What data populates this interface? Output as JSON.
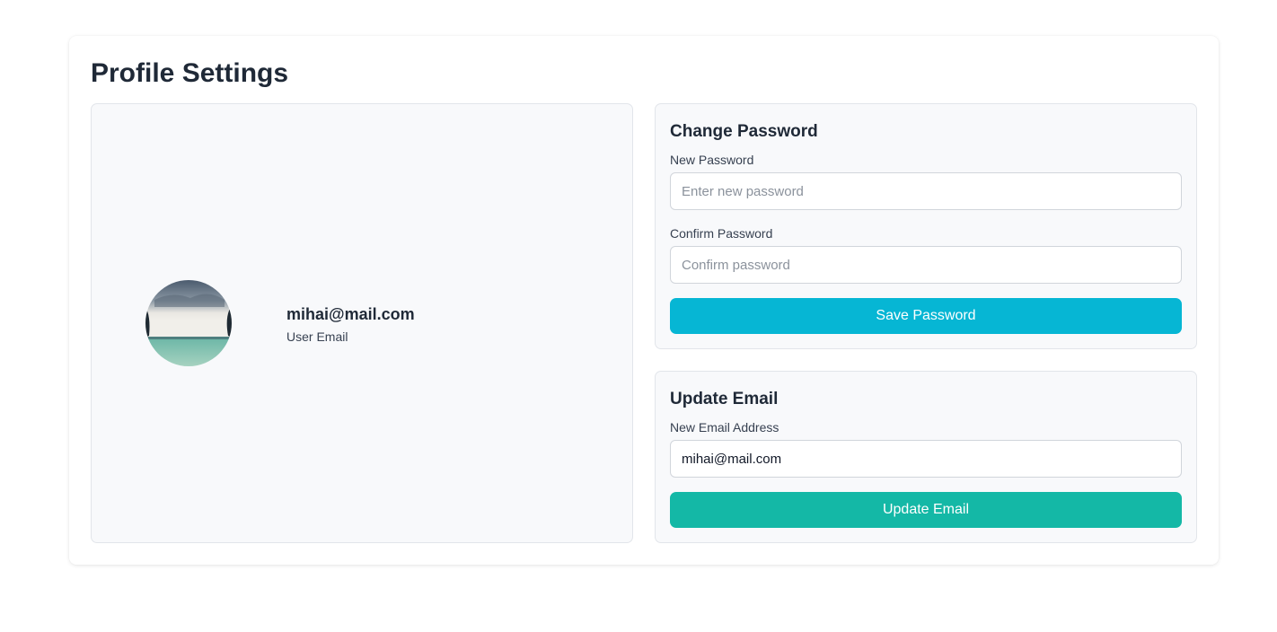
{
  "page": {
    "title": "Profile Settings"
  },
  "profile": {
    "email": "mihai@mail.com",
    "email_caption": "User Email"
  },
  "password_section": {
    "title": "Change Password",
    "new_label": "New Password",
    "new_placeholder": "Enter new password",
    "confirm_label": "Confirm Password",
    "confirm_placeholder": "Confirm password",
    "save_label": "Save Password"
  },
  "email_section": {
    "title": "Update Email",
    "field_label": "New Email Address",
    "field_value": "mihai@mail.com",
    "update_label": "Update Email"
  },
  "colors": {
    "save_button": "#06b6d4",
    "update_button": "#14b8a6",
    "panel_background": "#f8f9fb"
  }
}
